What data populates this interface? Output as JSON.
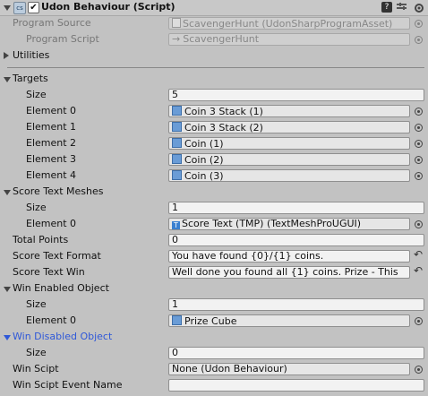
{
  "header": {
    "title": "Udon Behaviour (Script)",
    "enabled": true
  },
  "program_source": {
    "label": "Program Source",
    "value": "ScavengerHunt (UdonSharpProgramAsset)"
  },
  "program_script": {
    "label": "Program Script",
    "value": "ScavengerHunt"
  },
  "utilities": {
    "label": "Utilities"
  },
  "targets": {
    "label": "Targets",
    "size_label": "Size",
    "size": "5",
    "elements": [
      {
        "label": "Element 0",
        "value": "Coin 3 Stack (1)"
      },
      {
        "label": "Element 1",
        "value": "Coin 3 Stack (2)"
      },
      {
        "label": "Element 2",
        "value": "Coin (1)"
      },
      {
        "label": "Element 3",
        "value": "Coin (2)"
      },
      {
        "label": "Element 4",
        "value": "Coin (3)"
      }
    ]
  },
  "score_text_meshes": {
    "label": "Score Text Meshes",
    "size_label": "Size",
    "size": "1",
    "element_label": "Element 0",
    "element_value": "Score Text (TMP) (TextMeshProUGUI)"
  },
  "total_points": {
    "label": "Total Points",
    "value": "0"
  },
  "score_text_format": {
    "label": "Score Text Format",
    "value": "You have found {0}/{1} coins."
  },
  "score_text_win": {
    "label": "Score Text Win",
    "value": "Well done you found all {1} coins. Prize - This"
  },
  "win_enabled_object": {
    "label": "Win Enabled Object",
    "size_label": "Size",
    "size": "1",
    "element_label": "Element 0",
    "element_value": "Prize Cube"
  },
  "win_disabled_object": {
    "label": "Win Disabled Object",
    "size_label": "Size",
    "size": "0"
  },
  "win_script": {
    "label": "Win Scipt",
    "value": "None (Udon Behaviour)"
  },
  "win_script_event_name": {
    "label": "Win Scipt Event Name",
    "value": ""
  },
  "colors": {
    "modified_label": "#2f58d8",
    "panel": "#c2c2c2"
  }
}
